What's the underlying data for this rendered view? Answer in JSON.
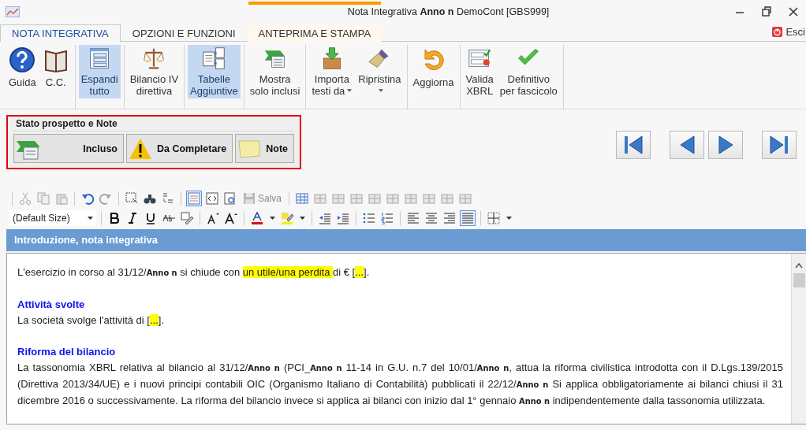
{
  "window": {
    "title": "Nota Integrativa **Anno n** DemoCont [GBS999]"
  },
  "tabs": [
    {
      "label": "NOTA INTEGRATIVA",
      "selected": true,
      "contextual": false
    },
    {
      "label": "OPZIONI E FUNZIONI",
      "selected": false,
      "contextual": false
    },
    {
      "label": "ANTEPRIMA E STAMPA",
      "selected": false,
      "contextual": true
    }
  ],
  "exit_button": {
    "label": "Esci"
  },
  "ribbon": {
    "groups": [
      {
        "buttons": [
          {
            "kind": "help",
            "label": "Guida",
            "selected": false,
            "dropdown": false
          },
          {
            "kind": "book",
            "label": "C.C.",
            "selected": false,
            "dropdown": false
          }
        ]
      },
      {
        "buttons": [
          {
            "kind": "list",
            "label": "Espandi\ntutto",
            "selected": true,
            "dropdown": false
          }
        ]
      },
      {
        "buttons": [
          {
            "kind": "scales",
            "label": "Bilancio IV\ndirettiva",
            "selected": false,
            "dropdown": false
          }
        ]
      },
      {
        "buttons": [
          {
            "kind": "documents",
            "label": "Tabelle\nAggiuntive",
            "selected": true,
            "dropdown": false
          }
        ]
      },
      {
        "buttons": [
          {
            "kind": "flag",
            "label": "Mostra\nsolo inclusi",
            "selected": false,
            "dropdown": false
          }
        ]
      },
      {
        "buttons": [
          {
            "kind": "import",
            "label": "Importa\ntesti da",
            "selected": false,
            "dropdown": true
          },
          {
            "kind": "brush",
            "label": "Ripristina",
            "selected": false,
            "dropdown": true
          }
        ]
      },
      {
        "buttons": [
          {
            "kind": "refresh",
            "label": "Aggiorna",
            "selected": false,
            "dropdown": false
          }
        ]
      },
      {
        "buttons": [
          {
            "kind": "validate",
            "label": "Valida\nXBRL",
            "selected": false,
            "dropdown": false
          },
          {
            "kind": "check",
            "label": "Definitivo\nper fascicolo",
            "selected": false,
            "dropdown": false
          }
        ]
      }
    ]
  },
  "status_panel": {
    "title": "Stato prospetto e Note",
    "buttons": [
      {
        "kind": "included",
        "label": "Incluso"
      },
      {
        "kind": "warning",
        "label": "Da Completare"
      },
      {
        "kind": "note",
        "label": "Note"
      }
    ]
  },
  "editor_toolbar": {
    "save_label": "Salva",
    "font_size": "(Default Size)",
    "view_modes": [
      {
        "kind": "design",
        "selected": true
      },
      {
        "kind": "html",
        "selected": false
      },
      {
        "kind": "preview",
        "selected": false
      }
    ],
    "alignment": [
      {
        "kind": "left",
        "selected": false
      },
      {
        "kind": "center",
        "selected": false
      },
      {
        "kind": "right",
        "selected": false
      },
      {
        "kind": "justify",
        "selected": true
      }
    ]
  },
  "section": {
    "title": "Introduzione, nota integrativa"
  },
  "document": {
    "blocks": [
      {
        "kind": "paragraph",
        "segments": [
          {
            "text": "L'esercizio in corso al 31/12/**Anno n** si chiude con ",
            "highlight": false
          },
          {
            "text": "un utile/una perdita ",
            "highlight": true
          },
          {
            "text": "di € [",
            "highlight": false
          },
          {
            "text": "...",
            "highlight": true
          },
          {
            "text": "].",
            "highlight": false
          }
        ]
      },
      {
        "kind": "heading",
        "segments": [
          {
            "text": "Attività svolte",
            "highlight": false
          }
        ]
      },
      {
        "kind": "paragraph",
        "segments": [
          {
            "text": "La società svolge l'attività di [",
            "highlight": false
          },
          {
            "text": "...",
            "highlight": true
          },
          {
            "text": "].",
            "highlight": false
          }
        ]
      },
      {
        "kind": "heading",
        "segments": [
          {
            "text": "Riforma del bilancio",
            "highlight": false
          }
        ]
      },
      {
        "kind": "paragraph",
        "segments": [
          {
            "text": "La tassonomia XBRL relativa al bilancio al 31/12/**Anno n** (PCI_**Anno n** 11-14 in G.U. n.7 del 10/01/**Anno n**, attua la riforma civilistica introdotta con il D.Lgs.139/2015 (Direttiva 2013/34/UE) e i nuovi principi contabili OIC (Organismo Italiano di Contabilità) pubblicati il 22/12/**Anno n** Si applica obbligatoriamente ai bilanci chiusi il 31 dicembre 2016 o successivamente. La riforma del bilancio invece si applica ai bilanci con inizio dal 1° gennaio **Anno n** indipendentemente dalla tassonomia utilizzata.",
            "highlight": false
          }
        ]
      }
    ]
  }
}
